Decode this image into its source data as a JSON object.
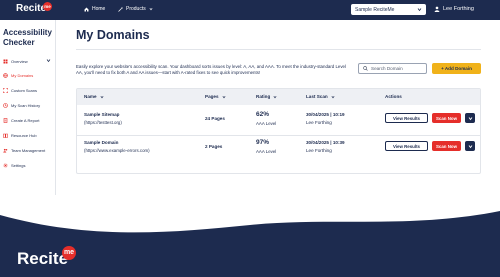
{
  "brand": {
    "logo_text": "Recite",
    "logo_badge": "me",
    "accent": "#e52e2a",
    "navy": "#1d2b4f",
    "gold": "#f0b21a"
  },
  "topnav": {
    "home_label": "Home",
    "products_label": "Products",
    "site_select_value": "Sample ReciteMe",
    "user_name": "Lee Forthing"
  },
  "sidebar": {
    "title": "Accessibility Checker",
    "items": [
      {
        "label": "Overview",
        "icon": "grid-icon"
      },
      {
        "label": "My Domains",
        "icon": "globe-icon"
      },
      {
        "label": "Custom Scans",
        "icon": "scan-icon"
      },
      {
        "label": "My Scan History",
        "icon": "history-icon"
      },
      {
        "label": "Create A Report",
        "icon": "report-icon"
      },
      {
        "label": "Resource Hub",
        "icon": "book-icon"
      },
      {
        "label": "Team Management",
        "icon": "team-icon"
      },
      {
        "label": "Settings",
        "icon": "gear-icon"
      }
    ]
  },
  "main": {
    "title": "My Domains",
    "intro": "Easily explore your website's accessibility scan. Your dashboard sorts issues by level: A, AA, and AAA. To meet the industry-standard Level AA, you'll need to fix both A and AA issues—start with A-rated fixes to see quick improvements!",
    "search_placeholder": "Search Domain",
    "add_label": "+ Add Domain"
  },
  "table": {
    "headers": {
      "name": "Name",
      "pages": "Pages",
      "rating": "Rating",
      "last_scan": "Last Scan",
      "actions": "Actions"
    },
    "rows": [
      {
        "name": "Sample Sitemap",
        "url": "(https://testtest.org)",
        "pages": "24 Pages",
        "rating": "62%",
        "level": "AAA Level",
        "scan_date": "30/04/2025 | 10:19",
        "scan_by": "Lee Forthing"
      },
      {
        "name": "Sample Domain",
        "url": "(https://www.example-errors.com)",
        "pages": "2 Pages",
        "rating": "97%",
        "level": "AAA Level",
        "scan_date": "30/04/2025 | 10:39",
        "scan_by": "Lee Forthing"
      }
    ],
    "view_label": "View Results",
    "scan_label": "Scan Now"
  },
  "footer": {
    "logo_text": "Recite",
    "logo_badge": "me"
  }
}
